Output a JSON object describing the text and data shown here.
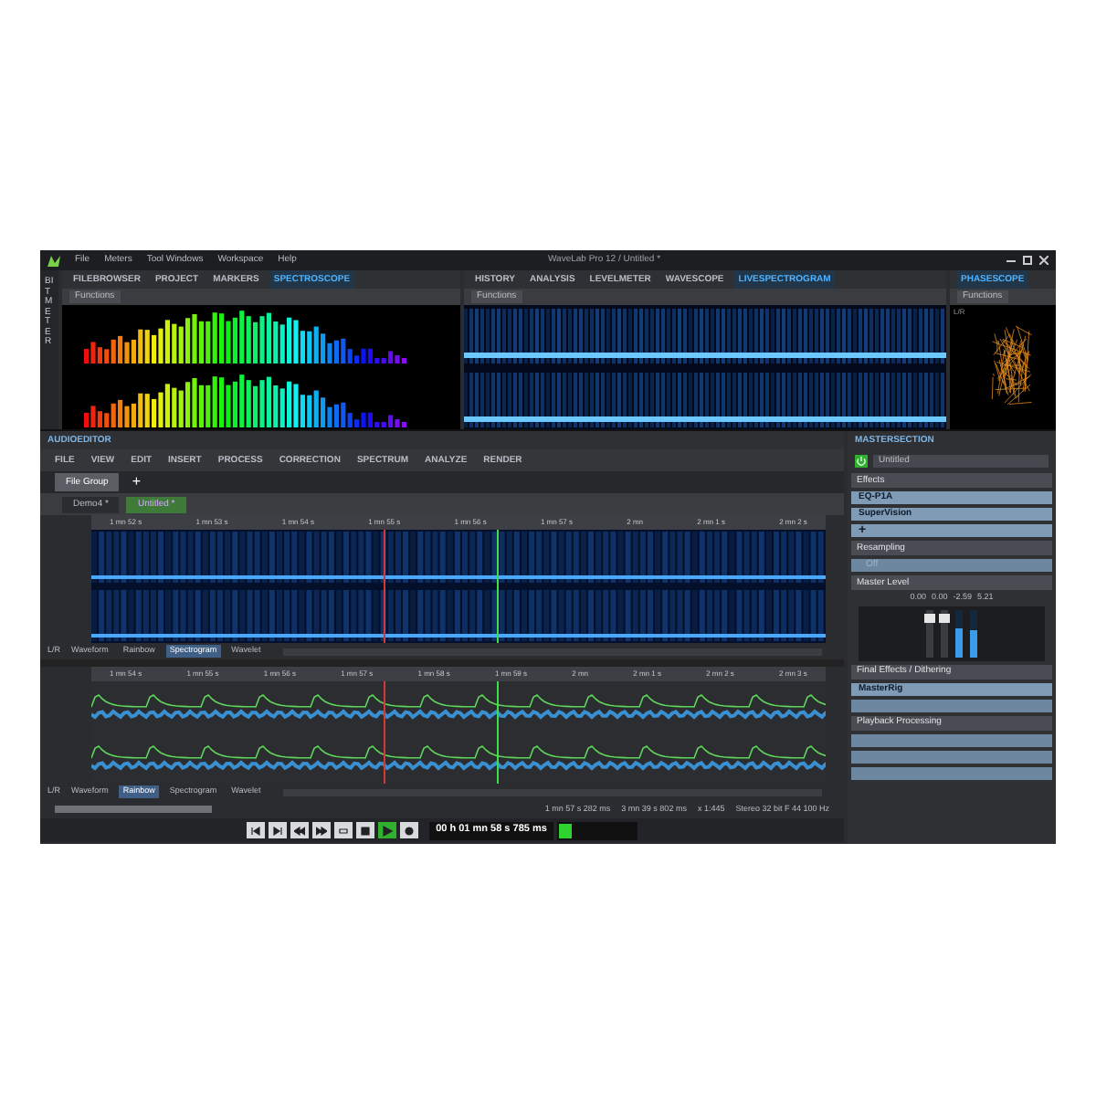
{
  "window": {
    "title": "WaveLab Pro 12 / Untitled *",
    "menu": [
      "File",
      "Meters",
      "Tool Windows",
      "Workspace",
      "Help"
    ]
  },
  "side_strip": [
    "BITMETER"
  ],
  "top_panels": [
    {
      "kind": "spectroscope",
      "tabs": [
        {
          "label": "FILEBROWSER",
          "selected": false
        },
        {
          "label": "PROJECT",
          "selected": false
        },
        {
          "label": "MARKERS",
          "selected": false
        },
        {
          "label": "SPECTROSCOPE",
          "selected": true
        }
      ],
      "functions_button": "Functions"
    },
    {
      "kind": "spectrogram",
      "tabs": [
        {
          "label": "HISTORY",
          "selected": false
        },
        {
          "label": "ANALYSIS",
          "selected": false
        },
        {
          "label": "LEVELMETER",
          "selected": false
        },
        {
          "label": "WAVESCOPE",
          "selected": false
        },
        {
          "label": "LIVESPECTROGRAM",
          "selected": true
        }
      ],
      "functions_button": "Functions"
    },
    {
      "kind": "phasescope",
      "tabs": [
        {
          "label": "PHASESCOPE",
          "selected": true
        }
      ],
      "functions_button": "Functions",
      "channel_label": "L/R"
    }
  ],
  "audio_editor": {
    "title": "AUDIOEDITOR",
    "toolbar": [
      "FILE",
      "VIEW",
      "EDIT",
      "INSERT",
      "PROCESS",
      "CORRECTION",
      "SPECTRUM",
      "ANALYZE",
      "RENDER"
    ],
    "file_group_tabs": [
      {
        "label": "File Group",
        "selected": true
      }
    ],
    "add_tab": "+",
    "documents": [
      {
        "label": "Demo4 *",
        "selected": false
      },
      {
        "label": "Untitled *",
        "selected": true
      }
    ],
    "views": [
      {
        "kind": "spectrogram",
        "ruler": [
          "1 mn 52 s",
          "1 mn 53 s",
          "1 mn 54 s",
          "1 mn 55 s",
          "1 mn 56 s",
          "1 mn 57 s",
          "2 mn",
          "2 mn 1 s",
          "2 mn 2 s"
        ],
        "channel": "L/R",
        "modes": [
          {
            "label": "Waveform",
            "selected": false
          },
          {
            "label": "Rainbow",
            "selected": false
          },
          {
            "label": "Spectrogram",
            "selected": true
          },
          {
            "label": "Wavelet",
            "selected": false
          }
        ]
      },
      {
        "kind": "waveform",
        "ruler": [
          "1 mn 54 s",
          "1 mn 55 s",
          "1 mn 56 s",
          "1 mn 57 s",
          "1 mn 58 s",
          "1 mn 59 s",
          "2 mn",
          "2 mn 1 s",
          "2 mn 2 s",
          "2 mn 3 s"
        ],
        "channel": "L/R",
        "modes": [
          {
            "label": "Waveform",
            "selected": false
          },
          {
            "label": "Rainbow",
            "selected": true
          },
          {
            "label": "Spectrogram",
            "selected": false
          },
          {
            "label": "Wavelet",
            "selected": false
          }
        ]
      }
    ],
    "status": {
      "cursor": "1 mn 57 s 282 ms",
      "length": "3 mn 39 s 802 ms",
      "zoom": "x 1:445",
      "format": "Stereo 32 bit F 44 100 Hz"
    },
    "transport": {
      "time": "00 h 01 mn 58 s 785 ms",
      "playing": true
    }
  },
  "master_section": {
    "title": "MASTERSECTION",
    "preset": "Untitled",
    "effects": {
      "title": "Effects",
      "slots": [
        {
          "kind": "plugin",
          "label": "EQ-P1A"
        },
        {
          "kind": "plugin",
          "label": "SuperVision"
        },
        {
          "kind": "add",
          "label": "+"
        }
      ]
    },
    "resampling": {
      "title": "Resampling",
      "slot": "Off"
    },
    "master_level": {
      "title": "Master Level",
      "readings": [
        "0.00",
        "0.00",
        "-2.59",
        "5.21"
      ],
      "meters": [
        {
          "level": 0.6
        },
        {
          "level": 0.55
        }
      ]
    },
    "final_effects": {
      "title": "Final Effects / Dithering",
      "slots": [
        {
          "kind": "plugin",
          "label": "MasterRig"
        },
        {
          "kind": "empty"
        }
      ]
    },
    "playback_processing": {
      "title": "Playback Processing",
      "slots": [
        {
          "kind": "empty"
        },
        {
          "kind": "empty"
        },
        {
          "kind": "empty"
        }
      ]
    }
  }
}
